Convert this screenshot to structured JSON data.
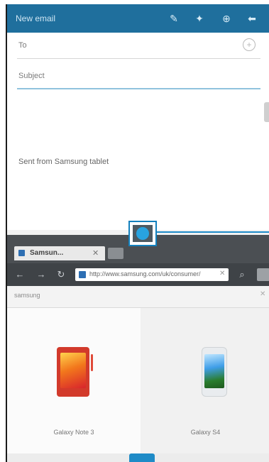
{
  "email": {
    "title": "New email",
    "to_label": "To",
    "subject_label": "Subject",
    "signature": "Sent from Samsung tablet",
    "icons": [
      "attach-icon",
      "insert-icon",
      "send-icon",
      "back-icon"
    ]
  },
  "browser": {
    "tab_label": "Samsun...",
    "url": "http://www.samsung.com/uk/consumer/",
    "strip_label": "samsung",
    "products": [
      {
        "name": "Galaxy Note 3"
      },
      {
        "name": "Galaxy S4"
      }
    ]
  },
  "colors": {
    "email_bar": "#1f6f9d",
    "accent": "#1f8bc7",
    "browser_bar": "#4b4f53"
  }
}
